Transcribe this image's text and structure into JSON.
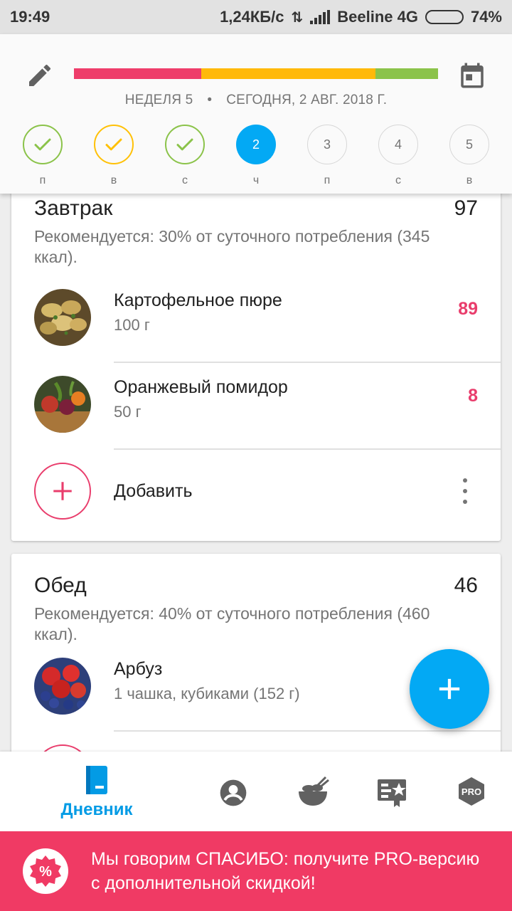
{
  "status_bar": {
    "time": "19:49",
    "net_speed": "1,24КБ/с",
    "carrier": "Beeline 4G",
    "battery": "74%",
    "battery_level": 0.74
  },
  "header": {
    "progress_colors": [
      "#ee3d6a",
      "#ffb90a",
      "#8bc34a"
    ],
    "week": "НЕДЕЛЯ 5",
    "separator": "•",
    "date": "СЕГОДНЯ, 2 АВГ. 2018 Г.",
    "days": [
      {
        "label": "п",
        "state": "done-green",
        "number": ""
      },
      {
        "label": "в",
        "state": "done-yellow",
        "number": ""
      },
      {
        "label": "с",
        "state": "done-green",
        "number": ""
      },
      {
        "label": "ч",
        "state": "today",
        "number": "2"
      },
      {
        "label": "п",
        "state": "future",
        "number": "3"
      },
      {
        "label": "с",
        "state": "future",
        "number": "4"
      },
      {
        "label": "в",
        "state": "future",
        "number": "5"
      }
    ],
    "colors": {
      "green": "#8bc34a",
      "yellow": "#ffc107",
      "today": "#03a9f4"
    }
  },
  "breakfast": {
    "title": "Завтрак",
    "total": "97",
    "recommendation": "Рекомендуется: 30% от суточного потребления (345 ккал).",
    "items": [
      {
        "name": "Картофельное пюре",
        "amount": "100 г",
        "calories": "89",
        "image": "potato-image"
      },
      {
        "name": "Оранжевый помидор",
        "amount": "50 г",
        "calories": "8",
        "image": "vegetables-image"
      }
    ],
    "add_label": "Добавить"
  },
  "lunch": {
    "title": "Обед",
    "total": "46",
    "recommendation": "Рекомендуется: 40% от суточного потребления (460 ккал).",
    "items": [
      {
        "name": "Арбуз",
        "amount": "1 чашка, кубиками (152 г)",
        "calories": "",
        "image": "berries-image"
      }
    ]
  },
  "bottom_nav": {
    "diary_label": "Дневник",
    "items": [
      "diary-icon",
      "profile-icon",
      "recipes-icon",
      "plans-icon",
      "pro-icon"
    ],
    "pro_badge": "PRO",
    "active_color": "#039be5"
  },
  "promo": {
    "text": "Мы говорим СПАСИБО: получите PRO-версию с дополнительной скидкой!",
    "color": "#f03a64"
  }
}
